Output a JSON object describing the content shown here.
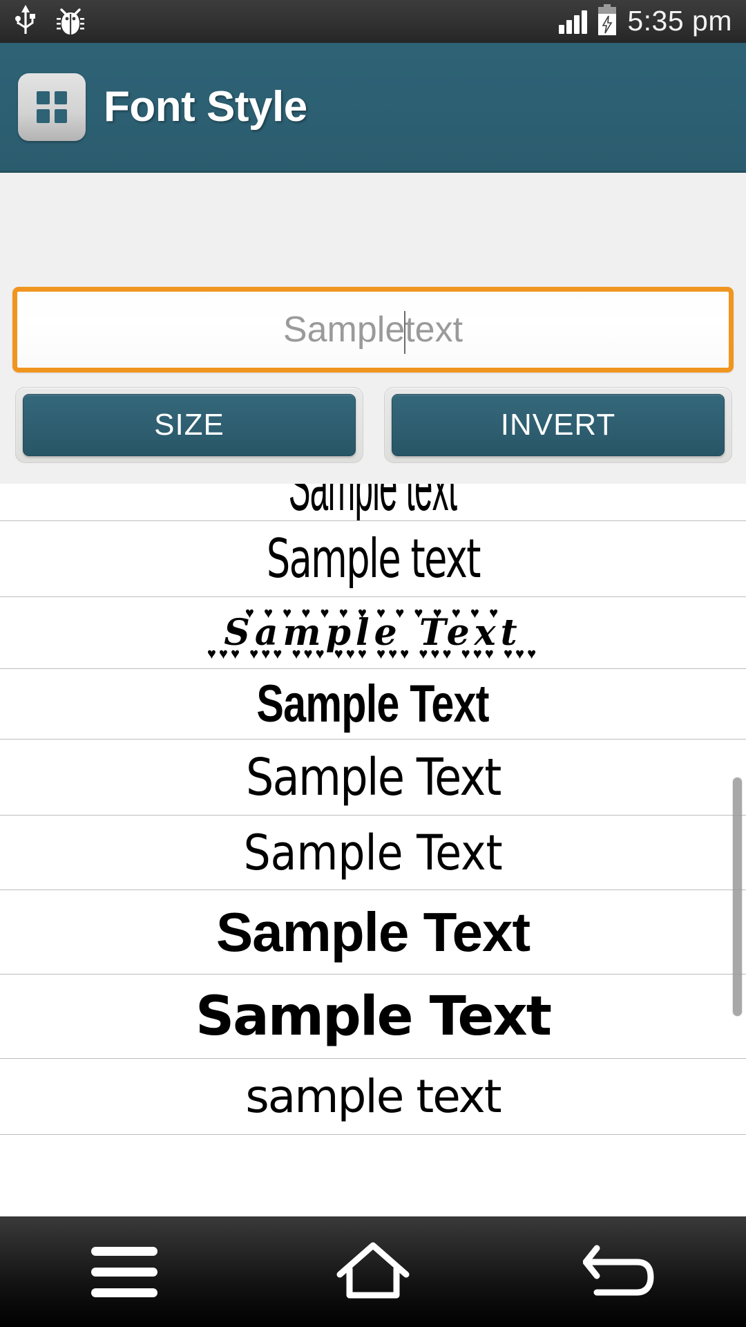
{
  "status_bar": {
    "icons": [
      "usb-icon",
      "bug-icon"
    ],
    "signal_icon": "signal-bars-icon",
    "battery_icon": "battery-charging-icon",
    "time": "5:35 pm"
  },
  "app_bar": {
    "icon": "grid-app-icon",
    "title": "Font Style"
  },
  "controls": {
    "input": {
      "value": "",
      "placeholder": "Sample text",
      "focus_color": "#f0951f"
    },
    "buttons": [
      {
        "label": "SIZE",
        "name": "size-button"
      },
      {
        "label": "INVERT",
        "name": "invert-button"
      }
    ],
    "button_color": "#2e5e70"
  },
  "font_list": {
    "items": [
      {
        "text": "Sample text",
        "style": "f-cond-tall",
        "clipped_top": true
      },
      {
        "text": "Sample text",
        "style": "f-quirk"
      },
      {
        "text": "Sample Text",
        "style": "f-hearts",
        "hearts": true
      },
      {
        "text": "Sample Text",
        "style": "f-heavy"
      },
      {
        "text": "Sample Text",
        "style": "f-marker"
      },
      {
        "text": "Sample Text",
        "style": "f-thin"
      },
      {
        "text": "Sample Text",
        "style": "f-bold1"
      },
      {
        "text": "Sample Text",
        "style": "f-bold2"
      },
      {
        "text": "sample text",
        "style": "f-clip",
        "clipped_bottom": true
      }
    ],
    "scrollbar_visible": true
  },
  "nav_bar": {
    "buttons": [
      {
        "name": "menu-button",
        "icon": "menu-icon"
      },
      {
        "name": "home-button",
        "icon": "home-icon"
      },
      {
        "name": "back-button",
        "icon": "back-arrow-icon"
      }
    ]
  }
}
